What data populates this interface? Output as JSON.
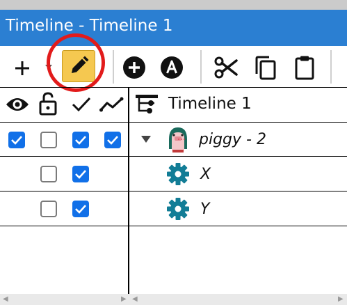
{
  "window": {
    "title": "Timeline - Timeline 1"
  },
  "toolbar": {
    "items": [
      {
        "name": "add",
        "icon": "plus-icon"
      },
      {
        "name": "add-dropdown",
        "icon": "caret-down-icon"
      },
      {
        "name": "edit",
        "icon": "pencil-icon",
        "state": "selected"
      },
      {
        "name": "add-keyframe",
        "icon": "circle-plus-icon"
      },
      {
        "name": "animate",
        "icon": "circle-a-icon"
      },
      {
        "name": "cut",
        "icon": "scissors-icon"
      },
      {
        "name": "copy",
        "icon": "copy-icon"
      },
      {
        "name": "paste",
        "icon": "clipboard-icon"
      }
    ]
  },
  "columns": {
    "icons": [
      "eye-icon",
      "lock-icon",
      "check-icon",
      "curve-icon"
    ],
    "timeline_label": "Timeline 1",
    "timeline_icon": "timeline-icon"
  },
  "rows": [
    {
      "label": "piggy - 2",
      "icon": "piggy-icon",
      "expanded": true,
      "visible": true,
      "locked": false,
      "enabled": true,
      "curves": true
    },
    {
      "label": "X",
      "icon": "gear-icon",
      "locked": false,
      "enabled": true
    },
    {
      "label": "Y",
      "icon": "gear-icon",
      "locked": false,
      "enabled": true
    }
  ],
  "colors": {
    "titlebar": "#2b7fd2",
    "checkbox_on": "#1170e8",
    "selected_tool": "#f5c850",
    "marker": "#e21b1b",
    "gear": "#127d96"
  }
}
